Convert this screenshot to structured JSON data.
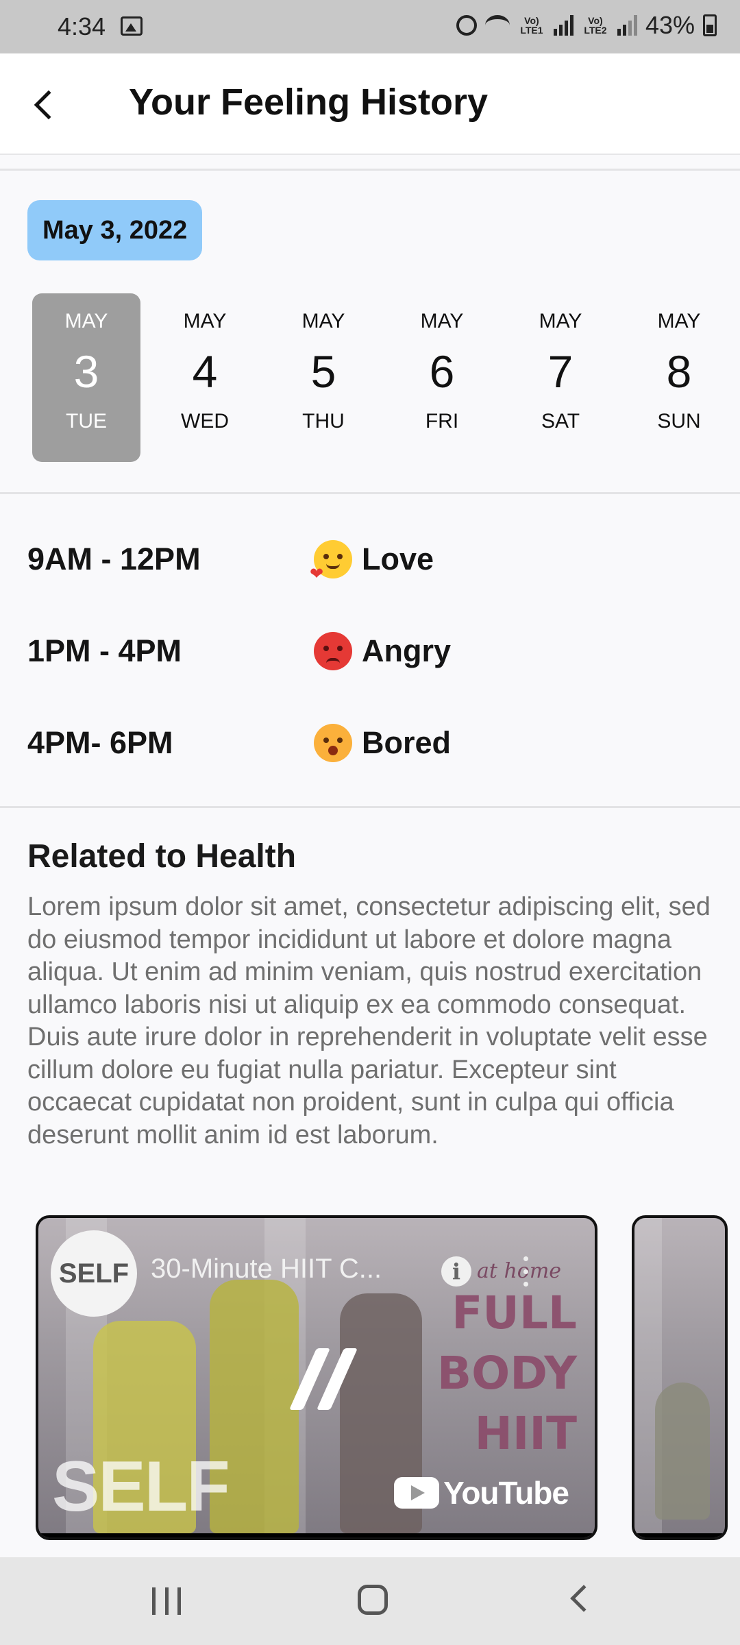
{
  "status_bar": {
    "time": "4:34",
    "lte1": "Vo) LTE1",
    "lte2": "Vo) LTE2",
    "battery": "43%"
  },
  "header": {
    "title": "Your Feeling History"
  },
  "selected_date": "May 3, 2022",
  "week": [
    {
      "month": "MAY",
      "day": "3",
      "weekday": "TUE",
      "selected": true
    },
    {
      "month": "MAY",
      "day": "4",
      "weekday": "WED",
      "selected": false
    },
    {
      "month": "MAY",
      "day": "5",
      "weekday": "THU",
      "selected": false
    },
    {
      "month": "MAY",
      "day": "6",
      "weekday": "FRI",
      "selected": false
    },
    {
      "month": "MAY",
      "day": "7",
      "weekday": "SAT",
      "selected": false
    },
    {
      "month": "MAY",
      "day": "8",
      "weekday": "SUN",
      "selected": false
    }
  ],
  "feelings": [
    {
      "time_range": "9AM - 12PM",
      "emoji": "love-emoji",
      "feeling": "Love"
    },
    {
      "time_range": "1PM - 4PM",
      "emoji": "angry-emoji",
      "feeling": "Angry"
    },
    {
      "time_range": "4PM- 6PM",
      "emoji": "bored-emoji",
      "feeling": "Bored"
    }
  ],
  "health": {
    "title": "Related to Health",
    "body": "Lorem ipsum dolor sit amet, consectetur adipiscing elit, sed do eiusmod tempor incididunt ut labore et dolore magna aliqua. Ut enim ad minim veniam, quis nostrud exercitation ullamco laboris nisi ut aliquip ex ea commodo consequat. Duis aute irure dolor in reprehenderit in voluptate velit esse cillum dolore eu fugiat nulla pariatur. Excepteur sint occaecat cupidatat non proident, sunt in culpa qui officia deserunt mollit anim id est laborum."
  },
  "video": {
    "channel": "SELF",
    "title": "30-Minute HIIT C...",
    "promo_small": "at home",
    "promo_lines": [
      "FULL",
      "BODY",
      "HIIT"
    ],
    "watermark": "SELF",
    "platform": "YouTube"
  },
  "colors": {
    "date_chip": "#90caf9",
    "selected_day": "#9e9e9e",
    "status_bar": "#c8c8c8"
  }
}
